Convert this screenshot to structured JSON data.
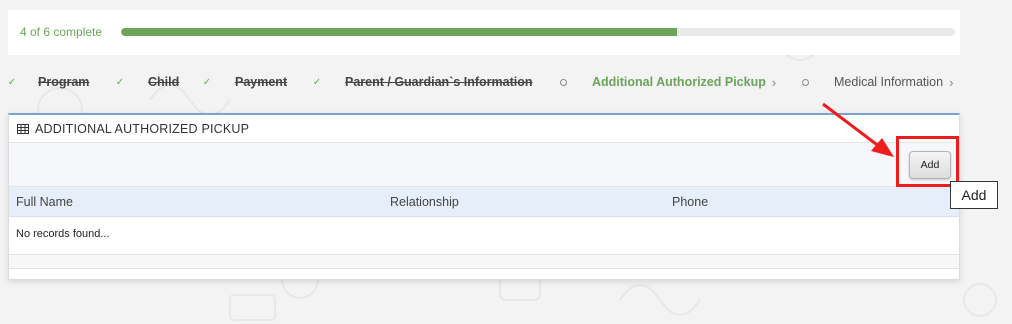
{
  "progress": {
    "label": "4 of 6 complete",
    "fraction": 0.667,
    "color": "#6aa55a"
  },
  "steps": [
    {
      "label": "Program",
      "state": "done"
    },
    {
      "label": "Child",
      "state": "done"
    },
    {
      "label": "Payment",
      "state": "done"
    },
    {
      "label": "Parent / Guardian`s Information",
      "state": "done"
    },
    {
      "label": "Additional Authorized Pickup",
      "state": "current"
    },
    {
      "label": "Medical Information",
      "state": "pending"
    }
  ],
  "panel": {
    "title": "ADDITIONAL AUTHORIZED PICKUP",
    "add_label": "Add",
    "columns": [
      "Full Name",
      "Relationship",
      "Phone"
    ],
    "empty_message": "No records found..."
  },
  "tooltip": {
    "text": "Add"
  },
  "colors": {
    "accent_green": "#6aa55a",
    "highlight_red": "#ee1c1c",
    "panel_border": "#7aa4cf"
  }
}
